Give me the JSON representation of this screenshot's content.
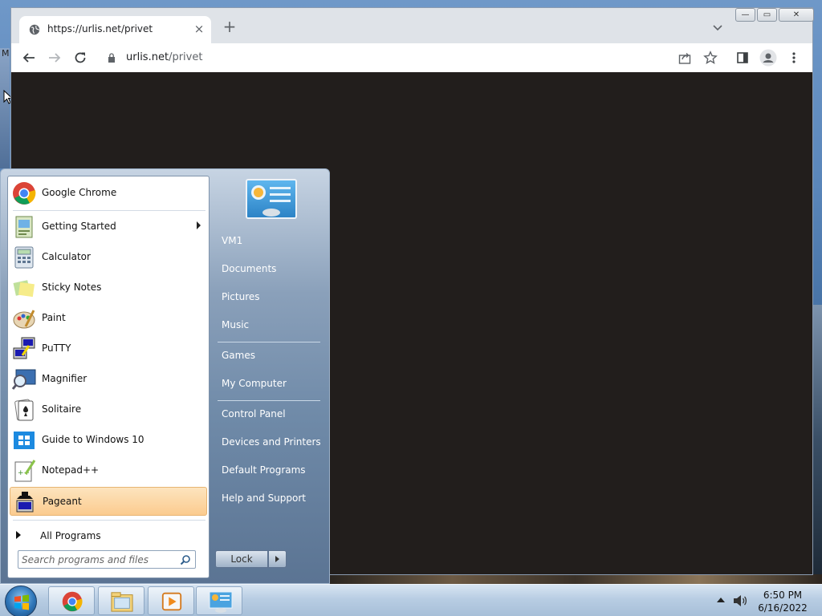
{
  "desktop": {
    "edge_text": "M"
  },
  "browser": {
    "tab": {
      "title": "https://urlis.net/privet",
      "close": "×"
    },
    "new_tab": "+",
    "window_buttons": {
      "minimize": "—",
      "maximize": "▭",
      "close": "✕"
    },
    "address": {
      "host": "urlis.net",
      "path": "/privet"
    },
    "content_color": "#221e1c"
  },
  "start_menu": {
    "programs": [
      {
        "label": "Google Chrome",
        "icon": "chrome-icon"
      },
      {
        "label": "Getting Started",
        "icon": "getting-started-icon",
        "submenu": true
      },
      {
        "label": "Calculator",
        "icon": "calculator-icon"
      },
      {
        "label": "Sticky Notes",
        "icon": "sticky-notes-icon"
      },
      {
        "label": "Paint",
        "icon": "paint-icon"
      },
      {
        "label": "PuTTY",
        "icon": "putty-icon"
      },
      {
        "label": "Magnifier",
        "icon": "magnifier-icon"
      },
      {
        "label": "Solitaire",
        "icon": "solitaire-icon"
      },
      {
        "label": "Guide to Windows 10",
        "icon": "windows-guide-icon"
      },
      {
        "label": "Notepad++",
        "icon": "notepadpp-icon"
      },
      {
        "label": "Pageant",
        "icon": "pageant-icon",
        "highlighted": true
      }
    ],
    "all_programs": "All Programs",
    "search_placeholder": "Search programs and files",
    "right_links": [
      "VM1",
      "Documents",
      "Pictures",
      "Music",
      "Games",
      "My Computer",
      "Control Panel",
      "Devices and Printers",
      "Default Programs",
      "Help and Support"
    ],
    "lock_label": "Lock"
  },
  "taskbar": {
    "apps": [
      "chrome-icon",
      "explorer-icon",
      "media-player-icon",
      "control-panel-icon"
    ],
    "time": "6:50 PM",
    "date": "6/16/2022"
  }
}
